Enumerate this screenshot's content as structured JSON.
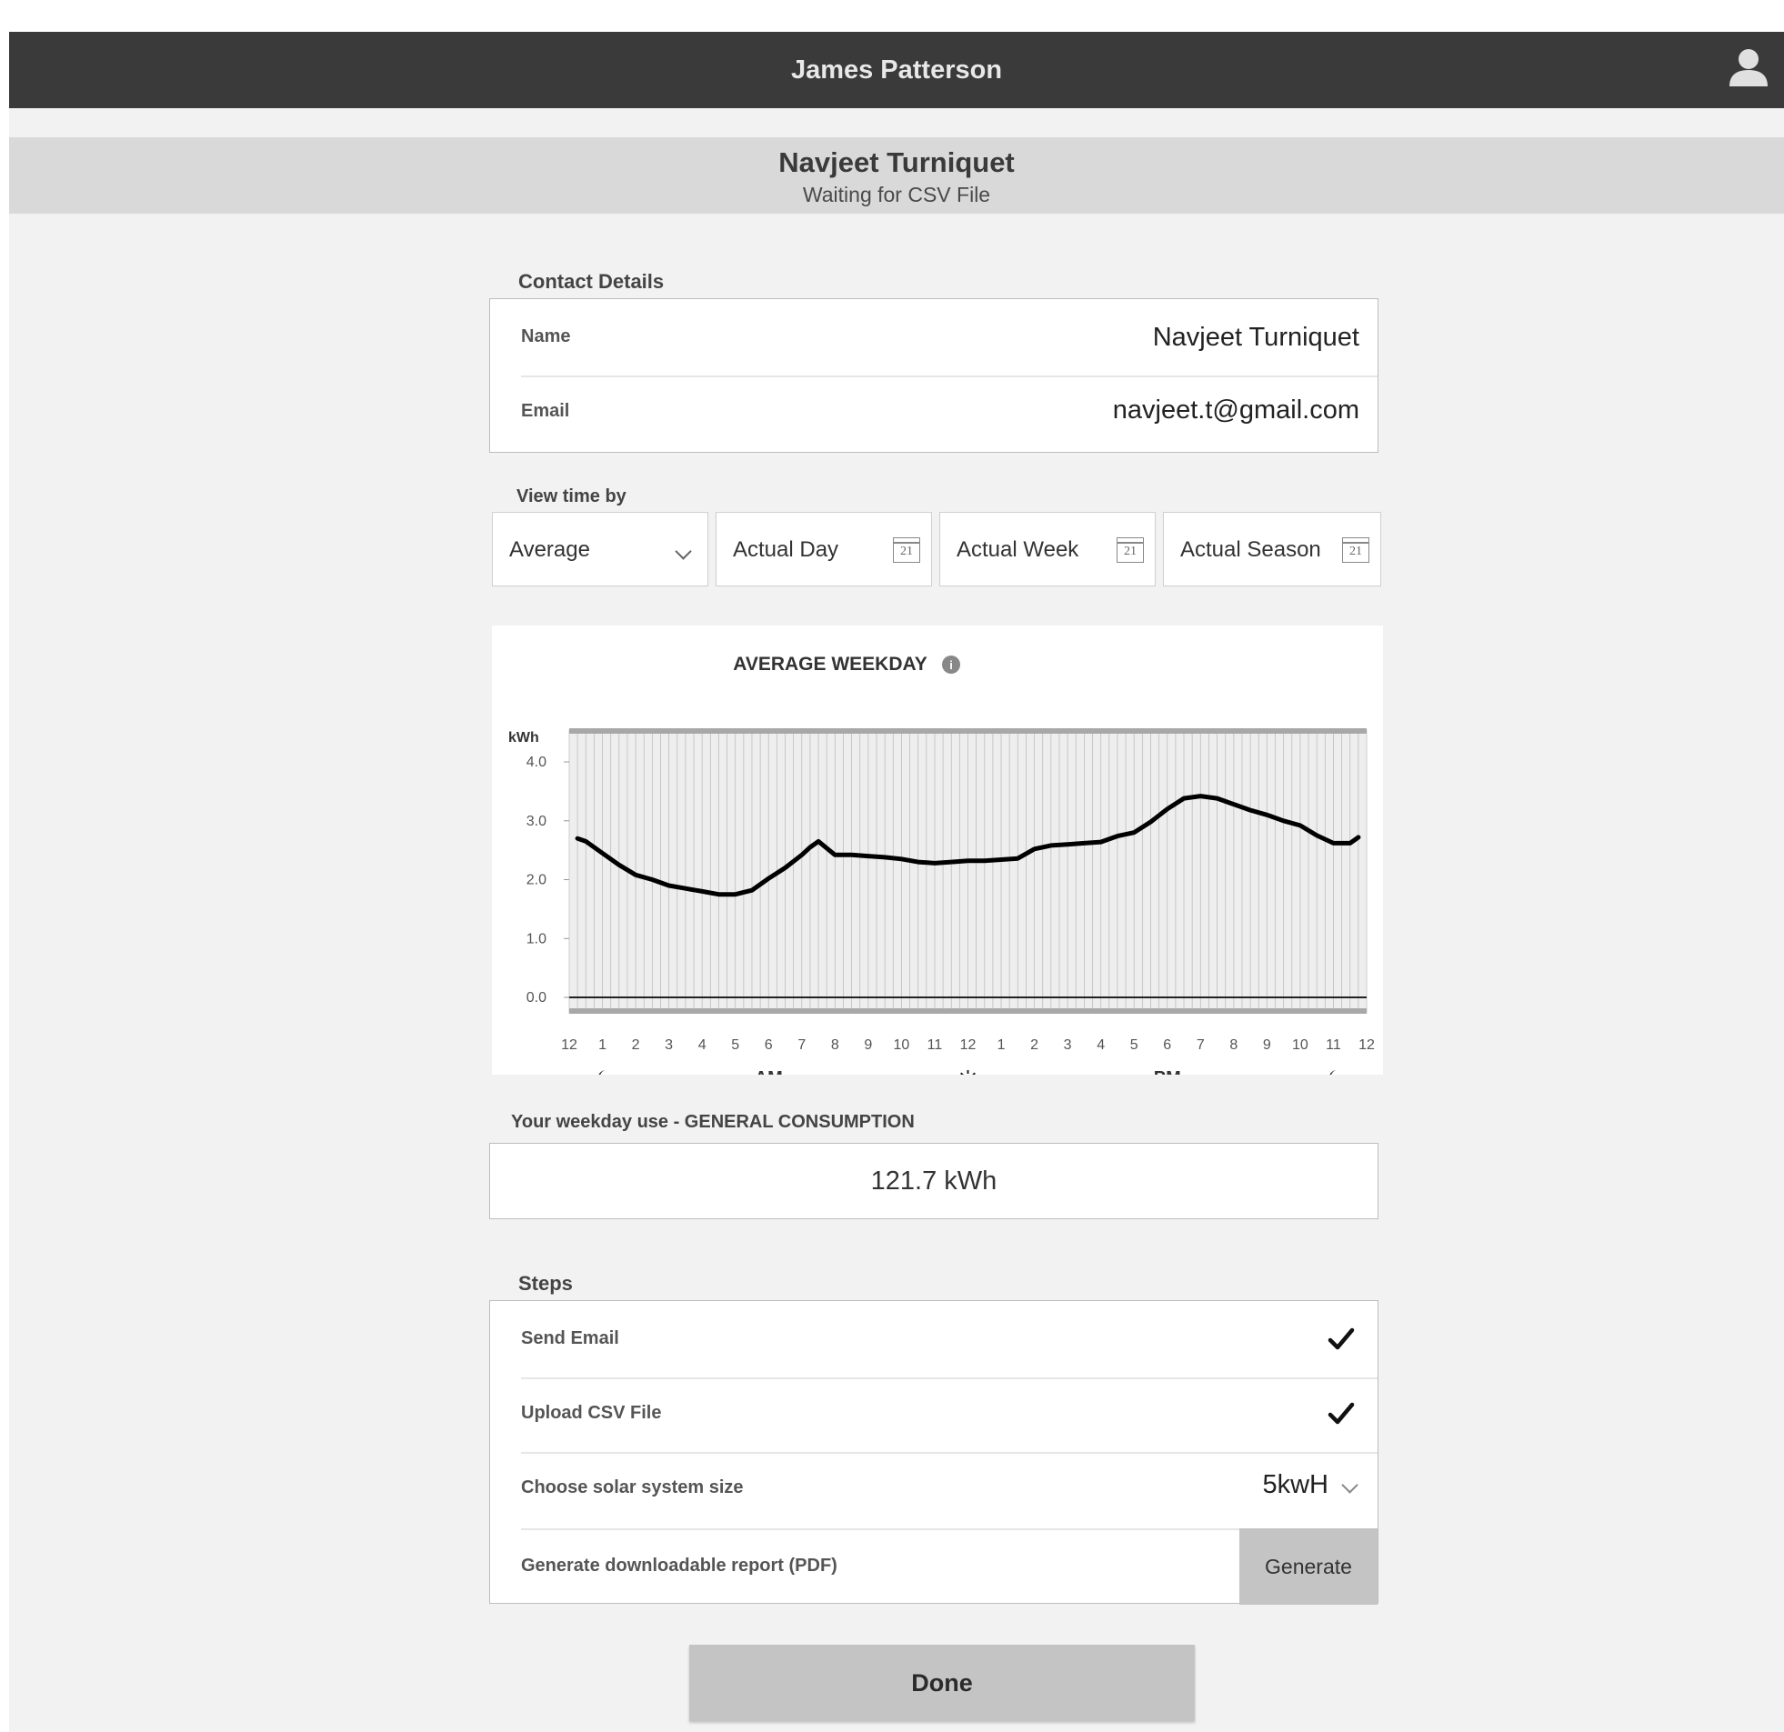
{
  "header": {
    "title": "James Patterson"
  },
  "subheader": {
    "name": "Navjeet Turniquet",
    "status": "Waiting for CSV File"
  },
  "contact": {
    "label": "Contact Details",
    "name_label": "Name",
    "name_value": "Navjeet Turniquet",
    "email_label": "Email",
    "email_value": "navjeet.t@gmail.com"
  },
  "view_time": {
    "label": "View time by",
    "options": [
      "Average",
      "Actual Day",
      "Actual Week",
      "Actual Season"
    ],
    "calendar_day": "21"
  },
  "chart_data": {
    "type": "line",
    "title": "AVERAGE WEEKDAY",
    "ylabel": "kWh",
    "ylim": [
      0,
      4.0
    ],
    "yticks": [
      "4.0",
      "3.0",
      "2.0",
      "1.0",
      "0.0"
    ],
    "x_tick_labels": [
      "12",
      "1",
      "2",
      "3",
      "4",
      "5",
      "6",
      "7",
      "8",
      "9",
      "10",
      "11",
      "12",
      "1",
      "2",
      "3",
      "4",
      "5",
      "6",
      "7",
      "8",
      "9",
      "10",
      "11",
      "12"
    ],
    "period_labels": [
      "AM",
      "PM"
    ],
    "period_icons": [
      "moon-icon",
      "sun-icon",
      "moon-icon"
    ],
    "grid": true,
    "series": [
      {
        "x": [
          0.25,
          0.5,
          0.75,
          1,
          1.5,
          2,
          2.5,
          3,
          3.5,
          4,
          4.5,
          5,
          5.5,
          6,
          6.5,
          7,
          7.25,
          7.5,
          8,
          8.5,
          9,
          9.5,
          10,
          10.5,
          11,
          11.5,
          12,
          12.5,
          13,
          13.5,
          14,
          14.5,
          15,
          15.5,
          16,
          16.5,
          17,
          17.5,
          18,
          18.5,
          19,
          19.5,
          20,
          20.5,
          21,
          21.5,
          22,
          22.5,
          23,
          23.5,
          23.75
        ],
        "values": [
          2.7,
          2.65,
          2.55,
          2.45,
          2.25,
          2.08,
          2.0,
          1.9,
          1.85,
          1.8,
          1.75,
          1.75,
          1.82,
          2.02,
          2.2,
          2.42,
          2.55,
          2.65,
          2.42,
          2.42,
          2.4,
          2.38,
          2.35,
          2.3,
          2.28,
          2.3,
          2.32,
          2.32,
          2.34,
          2.36,
          2.52,
          2.58,
          2.6,
          2.62,
          2.64,
          2.74,
          2.8,
          2.98,
          3.2,
          3.38,
          3.42,
          3.38,
          3.28,
          3.18,
          3.1,
          3.0,
          2.92,
          2.75,
          2.62,
          2.62,
          2.72
        ]
      }
    ]
  },
  "usage": {
    "label": "Your weekday use - GENERAL CONSUMPTION",
    "value": "121.7 kWh"
  },
  "steps": {
    "label": "Steps",
    "send_email": "Send Email",
    "upload_csv": "Upload CSV File",
    "solar_size_label": "Choose solar system size",
    "solar_size_value": "5kwH",
    "report_label": "Generate downloadable report (PDF)",
    "generate_button": "Generate"
  },
  "done_button": "Done"
}
